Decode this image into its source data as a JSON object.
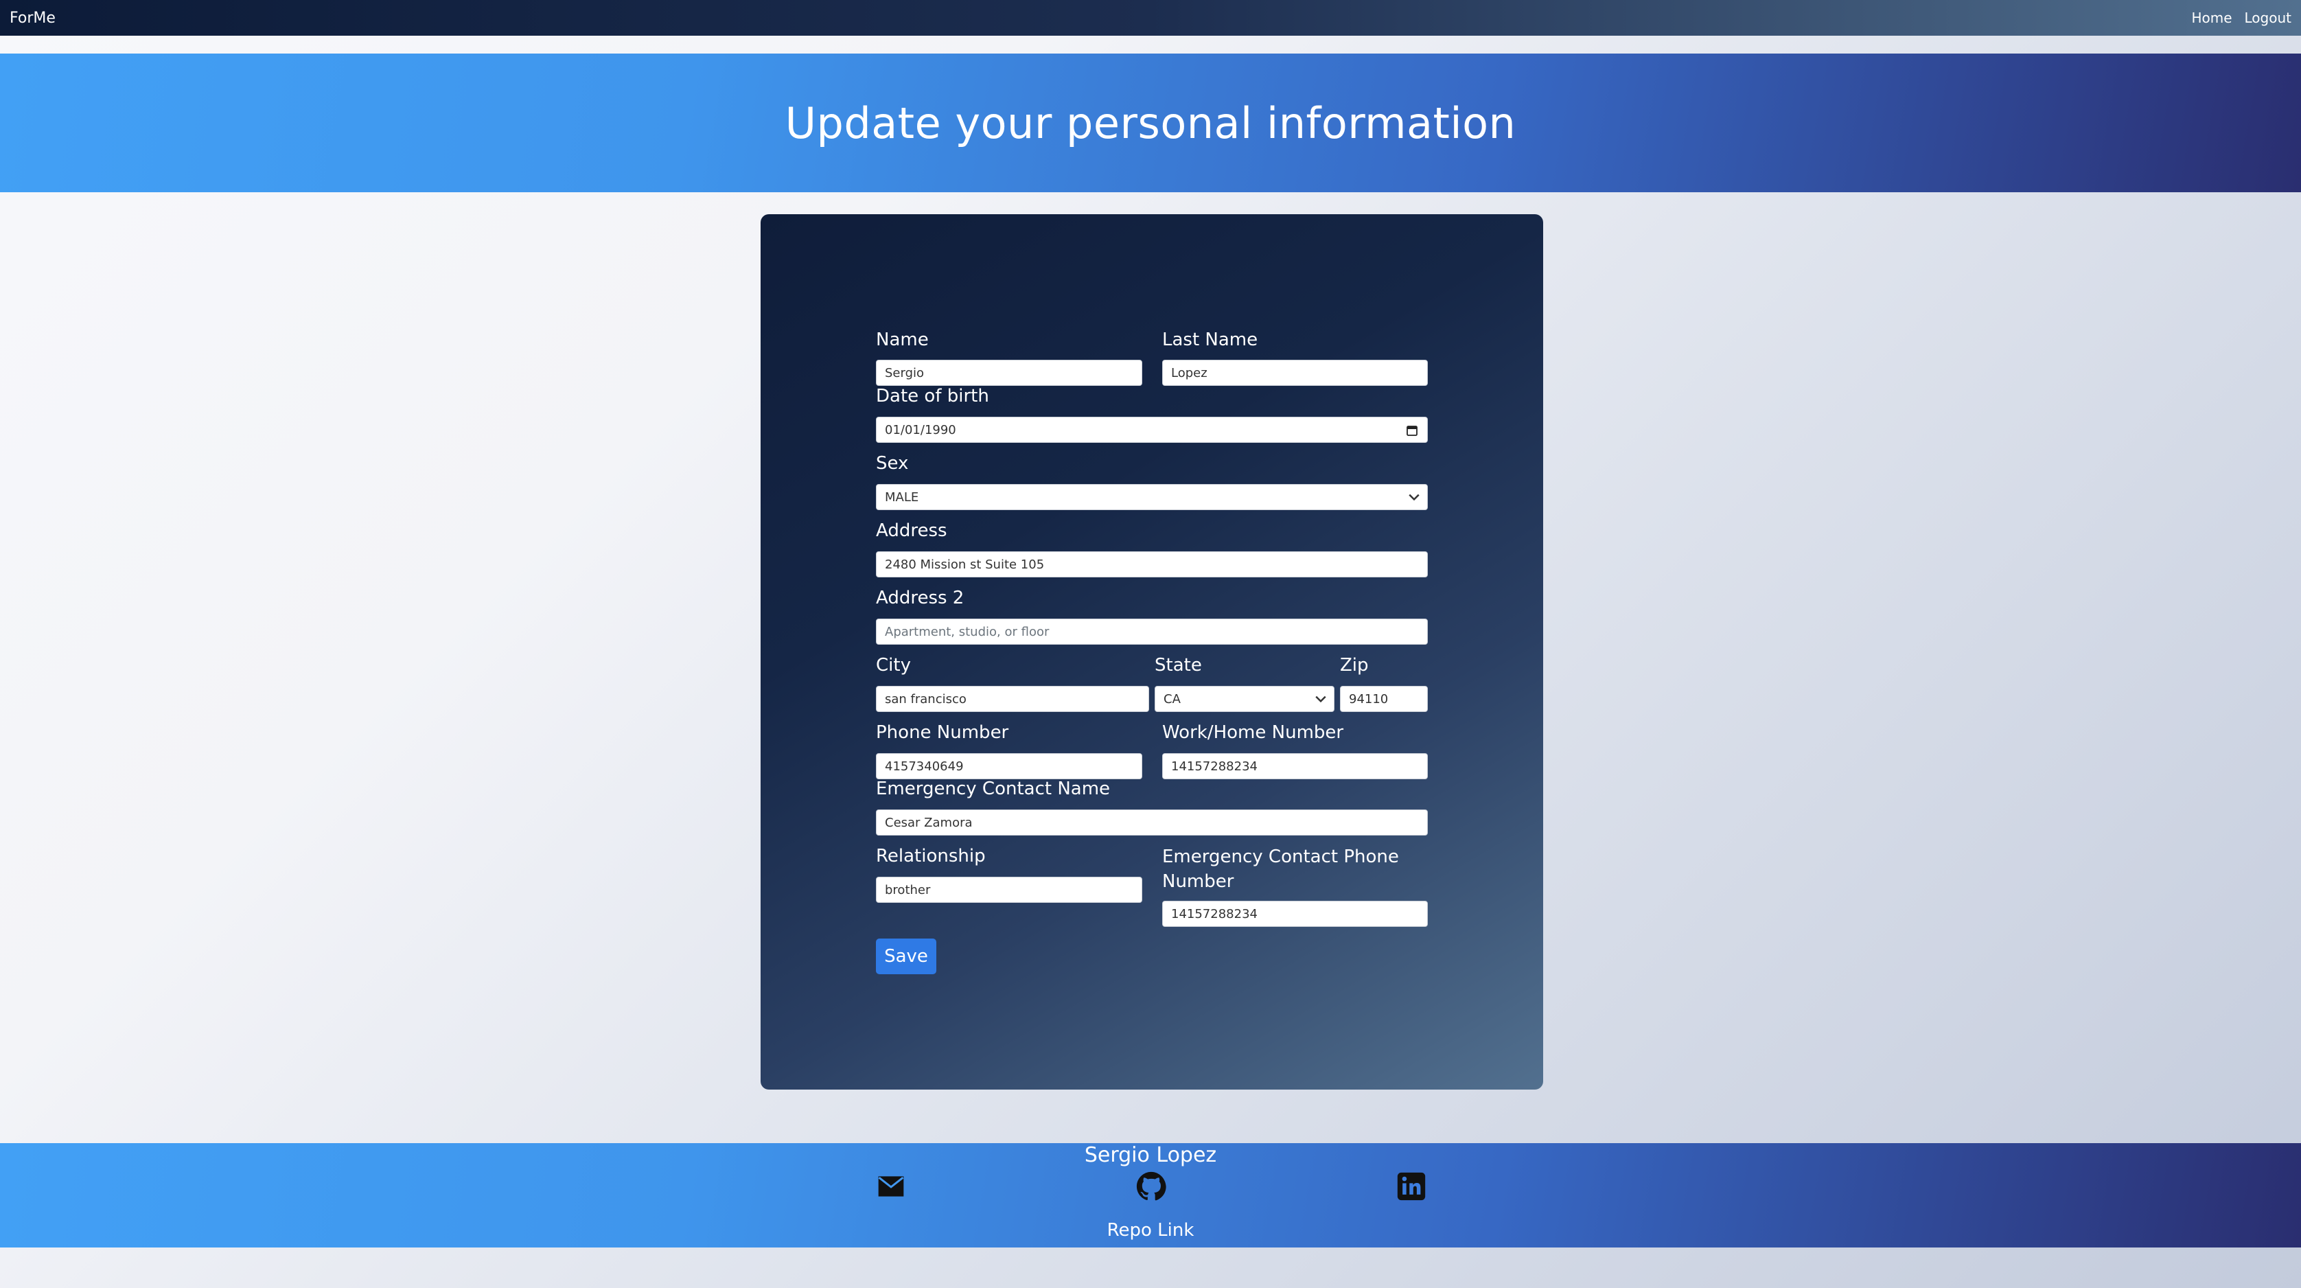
{
  "navbar": {
    "brand": "ForMe",
    "links": [
      "Home",
      "Logout"
    ]
  },
  "hero": {
    "title": "Update your personal information"
  },
  "form": {
    "name": {
      "label": "Name",
      "value": "Sergio"
    },
    "last_name": {
      "label": "Last Name",
      "value": "Lopez"
    },
    "dob": {
      "label": "Date of birth",
      "value": "01/01/1990"
    },
    "sex": {
      "label": "Sex",
      "value": "MALE"
    },
    "address": {
      "label": "Address",
      "value": "2480 Mission st Suite 105"
    },
    "address2": {
      "label": "Address 2",
      "placeholder": "Apartment, studio, or floor"
    },
    "city": {
      "label": "City",
      "value": "san francisco"
    },
    "state": {
      "label": "State",
      "value": "CA"
    },
    "zip": {
      "label": "Zip",
      "value": "94110"
    },
    "phone": {
      "label": "Phone Number",
      "value": "4157340649"
    },
    "work_phone": {
      "label": "Work/Home Number",
      "value": "14157288234"
    },
    "emergency_name": {
      "label": "Emergency Contact Name",
      "value": "Cesar Zamora"
    },
    "relationship": {
      "label": "Relationship",
      "value": "brother"
    },
    "emergency_phone": {
      "label": "Emergency Contact Phone Number",
      "value": "14157288234"
    },
    "save_label": "Save"
  },
  "footer": {
    "name": "Sergio Lopez",
    "icons": [
      "envelope-icon",
      "github-icon",
      "linkedin-icon"
    ],
    "repo_link": "Repo Link"
  }
}
